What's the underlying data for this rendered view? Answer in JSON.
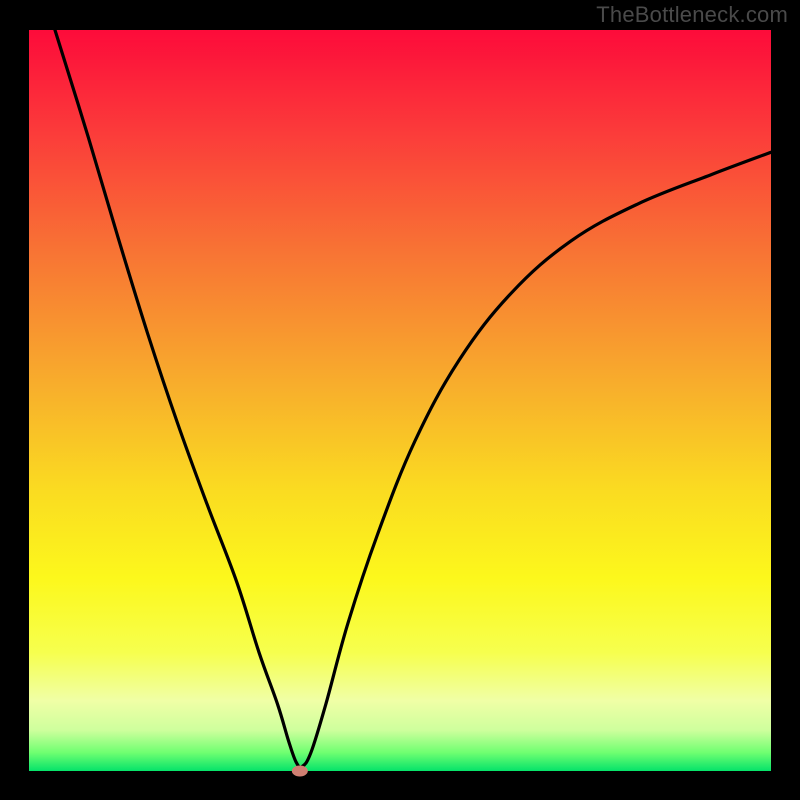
{
  "watermark": "TheBottleneck.com",
  "chart_data": {
    "type": "line",
    "title": "",
    "xlabel": "",
    "ylabel": "",
    "xlim": [
      0,
      100
    ],
    "ylim": [
      0,
      100
    ],
    "grid": false,
    "legend": false,
    "annotations": [
      {
        "type": "marker",
        "x": 36.5,
        "y": 0,
        "color": "#cf7f72",
        "shape": "ellipse"
      }
    ],
    "series": [
      {
        "name": "curve",
        "color": "#000000",
        "x": [
          3.5,
          8,
          12,
          16,
          20,
          24,
          28,
          31,
          33.5,
          35,
          36,
          36.8,
          38,
          40,
          43,
          47,
          52,
          58,
          65,
          73,
          82,
          92,
          100
        ],
        "y": [
          100,
          85.5,
          72,
          59,
          47,
          36,
          25.5,
          16,
          9,
          4,
          1.2,
          0.6,
          2.5,
          9,
          20,
          32,
          44.5,
          55.5,
          64.5,
          71.5,
          76.5,
          80.5,
          83.5
        ]
      }
    ],
    "background_gradient": {
      "type": "vertical",
      "stops": [
        {
          "offset": 0.0,
          "color": "#fd0b3a"
        },
        {
          "offset": 0.14,
          "color": "#fb3c3a"
        },
        {
          "offset": 0.3,
          "color": "#f87434"
        },
        {
          "offset": 0.48,
          "color": "#f8ae2c"
        },
        {
          "offset": 0.62,
          "color": "#fadb21"
        },
        {
          "offset": 0.74,
          "color": "#fcf81c"
        },
        {
          "offset": 0.84,
          "color": "#f6ff4e"
        },
        {
          "offset": 0.905,
          "color": "#f0ffa6"
        },
        {
          "offset": 0.945,
          "color": "#ceff9d"
        },
        {
          "offset": 0.975,
          "color": "#70ff71"
        },
        {
          "offset": 1.0,
          "color": "#05e36a"
        }
      ]
    }
  }
}
